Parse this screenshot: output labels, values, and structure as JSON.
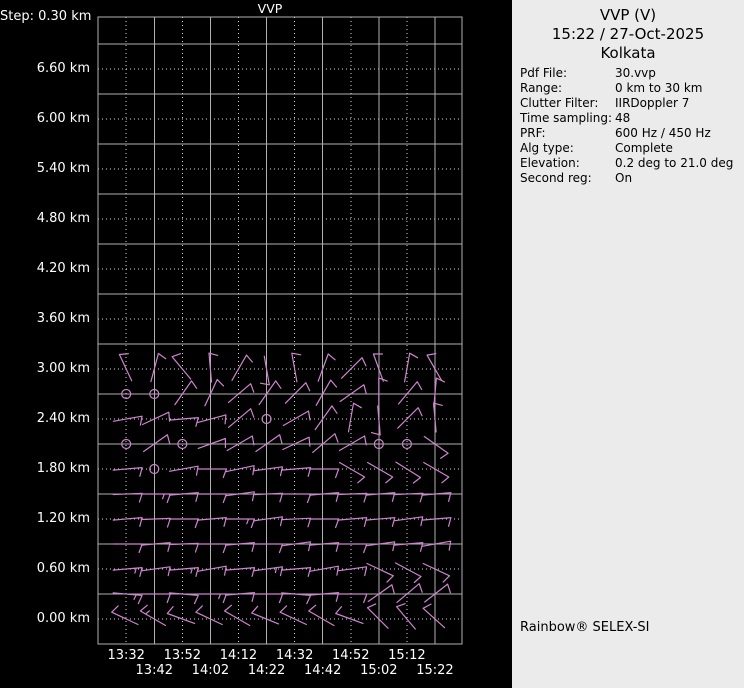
{
  "left_panel": {
    "step_label": "Step: 0.30 km",
    "chart_title": "VVP",
    "y_axis_labels": [
      "6.60 km",
      "6.00 km",
      "5.40 km",
      "4.80 km",
      "4.20 km",
      "3.60 km",
      "3.00 km",
      "2.40 km",
      "1.80 km",
      "1.20 km",
      "0.60 km",
      "0.00 km"
    ],
    "x_axis_times": [
      "13:32",
      "13:42",
      "13:52",
      "14:02",
      "14:12",
      "14:22",
      "14:32",
      "14:42",
      "14:52",
      "15:02",
      "15:12",
      "15:22"
    ]
  },
  "right_panel": {
    "title": "VVP (V)",
    "datetime": "15:22 / 27-Oct-2025",
    "site": "Kolkata",
    "fields": [
      {
        "label": "Pdf File:",
        "value": "30.vvp"
      },
      {
        "label": "Range:",
        "value": "0 km to 30 km"
      },
      {
        "label": "Clutter Filter:",
        "value": "IIRDoppler 7"
      },
      {
        "label": "Time sampling:",
        "value": "48"
      },
      {
        "label": "PRF:",
        "value": "600 Hz / 450 Hz"
      },
      {
        "label": "Alg type:",
        "value": "Complete"
      },
      {
        "label": "Elevation:",
        "value": "0.2 deg to 21.0 deg"
      },
      {
        "label": "Second reg:",
        "value": "On"
      }
    ],
    "footer": "Rainbow® SELEX-SI"
  },
  "colors": {
    "background": "#000000",
    "barb": "#ce84ce",
    "grid_solid": "#b0b0b0",
    "grid_dotted": "#d8d8d8",
    "axis_text": "#ffffff",
    "panel_bg": "#ebebeb",
    "panel_text": "#111111"
  },
  "chart_data": {
    "type": "wind-barb-time-height",
    "title": "VVP",
    "xlabel": "",
    "ylabel": "",
    "x_times": [
      "13:32",
      "13:42",
      "13:52",
      "14:02",
      "14:12",
      "14:22",
      "14:32",
      "14:42",
      "14:52",
      "15:02",
      "15:12",
      "15:22"
    ],
    "y_axis_tick_labels_km": [
      6.6,
      6.0,
      5.4,
      4.8,
      4.2,
      3.6,
      3.0,
      2.4,
      1.8,
      1.2,
      0.6,
      0.0
    ],
    "ylim_km": [
      0.0,
      7.2
    ],
    "height_step_km": 0.3,
    "grid": "solid every 0.60 km and 20 min, dotted every 0.30 km and alternating 10 min",
    "legend_position": "none",
    "cell_format": "[staff_angle_deg_screen_ccw_from_east, tick_count] | 'C' = calm circle | null = no data",
    "levels": [
      {
        "km": "3.00",
        "cells": [
          [
            115,
            1
          ],
          [
            75,
            1
          ],
          [
            130,
            1
          ],
          [
            95,
            1
          ],
          [
            60,
            1
          ],
          [
            280,
            1
          ],
          [
            100,
            1
          ],
          [
            70,
            1
          ],
          [
            45,
            1
          ],
          [
            110,
            1
          ],
          [
            80,
            1
          ],
          [
            120,
            1
          ]
        ]
      },
      {
        "km": "2.70",
        "cells": [
          "C",
          "C",
          [
            55,
            1
          ],
          [
            65,
            1
          ],
          [
            40,
            1
          ],
          [
            55,
            1
          ],
          [
            45,
            1
          ],
          [
            60,
            1
          ],
          [
            35,
            1
          ],
          [
            90,
            1
          ],
          [
            50,
            1
          ],
          [
            85,
            1
          ]
        ]
      },
      {
        "km": "2.40",
        "cells": [
          [
            10,
            1
          ],
          [
            25,
            1
          ],
          [
            5,
            1
          ],
          [
            15,
            1
          ],
          [
            40,
            1
          ],
          "C",
          [
            30,
            1
          ],
          [
            55,
            1
          ],
          [
            80,
            1
          ],
          [
            275,
            1
          ],
          [
            45,
            1
          ],
          [
            95,
            1
          ]
        ]
      },
      {
        "km": "2.10",
        "cells": [
          "C",
          [
            35,
            1
          ],
          "C",
          [
            20,
            1
          ],
          [
            30,
            1
          ],
          [
            35,
            1
          ],
          [
            25,
            1
          ],
          [
            40,
            1
          ],
          [
            30,
            1
          ],
          "C",
          "C",
          [
            -35,
            1
          ]
        ]
      },
      {
        "km": "1.80",
        "cells": [
          [
            5,
            1
          ],
          "C",
          [
            10,
            1
          ],
          [
            0,
            1
          ],
          [
            12,
            1
          ],
          [
            8,
            1
          ],
          [
            5,
            1
          ],
          [
            0,
            1
          ],
          [
            -30,
            1
          ],
          [
            -30,
            1
          ],
          [
            -32,
            1
          ],
          [
            -30,
            1
          ]
        ]
      },
      {
        "km": "1.50",
        "cells": [
          [
            2,
            1
          ],
          [
            0,
            1.5
          ],
          [
            5,
            1
          ],
          [
            0,
            1
          ],
          [
            8,
            1
          ],
          [
            3,
            1
          ],
          [
            0,
            1
          ],
          [
            5,
            1
          ],
          [
            2,
            1
          ],
          [
            5,
            1
          ],
          [
            3,
            1
          ],
          [
            5,
            1
          ]
        ]
      },
      {
        "km": "1.20",
        "cells": [
          [
            5,
            1
          ],
          [
            2,
            1
          ],
          [
            0,
            1
          ],
          [
            5,
            1
          ],
          [
            0,
            1.5
          ],
          [
            8,
            1
          ],
          [
            3,
            1
          ],
          [
            0,
            1
          ],
          [
            5,
            1
          ],
          [
            5,
            1
          ],
          [
            8,
            1
          ],
          [
            5,
            1
          ]
        ]
      },
      {
        "km": "0.90",
        "cells": [
          [
            0,
            1
          ],
          [
            5,
            1
          ],
          [
            2,
            1
          ],
          [
            0,
            1
          ],
          [
            5,
            1
          ],
          [
            0,
            1
          ],
          [
            8,
            1
          ],
          [
            5,
            1
          ],
          [
            0,
            1
          ],
          [
            8,
            1
          ],
          [
            5,
            1
          ],
          [
            10,
            1
          ]
        ]
      },
      {
        "km": "0.60",
        "cells": [
          [
            5,
            1.5
          ],
          [
            8,
            1
          ],
          [
            5,
            1.5
          ],
          [
            10,
            1
          ],
          [
            5,
            1
          ],
          [
            8,
            1.5
          ],
          [
            5,
            1
          ],
          [
            10,
            1
          ],
          [
            8,
            1
          ],
          [
            -25,
            1
          ],
          [
            -28,
            1
          ],
          [
            -25,
            1
          ]
        ]
      },
      {
        "km": "0.30",
        "cells": [
          [
            -5,
            1.5
          ],
          [
            0,
            1
          ],
          [
            -5,
            1
          ],
          [
            0,
            1.5
          ],
          [
            5,
            1
          ],
          [
            0,
            1
          ],
          [
            -5,
            1
          ],
          [
            5,
            1
          ],
          [
            0,
            1
          ],
          [
            35,
            1
          ],
          [
            40,
            1
          ],
          [
            38,
            1
          ]
        ]
      },
      {
        "km": "0.00",
        "cells": [
          [
            155,
            1
          ],
          [
            150,
            1.5
          ],
          [
            160,
            1
          ],
          [
            155,
            1
          ],
          [
            150,
            1
          ],
          [
            158,
            1
          ],
          [
            155,
            1
          ],
          [
            150,
            1
          ],
          [
            160,
            1
          ],
          [
            135,
            1
          ],
          [
            130,
            1
          ],
          [
            138,
            1
          ]
        ]
      }
    ]
  }
}
